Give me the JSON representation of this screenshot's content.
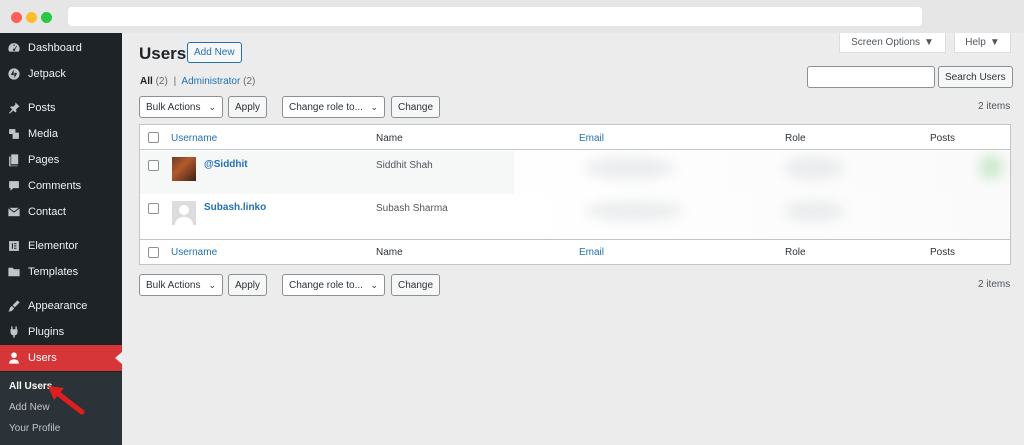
{
  "sidebar": {
    "items": [
      {
        "label": "Dashboard",
        "icon": "dashboard-icon"
      },
      {
        "label": "Jetpack",
        "icon": "jetpack-icon"
      },
      {
        "label": "Posts",
        "icon": "pin-icon"
      },
      {
        "label": "Media",
        "icon": "media-icon"
      },
      {
        "label": "Pages",
        "icon": "pages-icon"
      },
      {
        "label": "Comments",
        "icon": "comment-icon"
      },
      {
        "label": "Contact",
        "icon": "envelope-icon"
      },
      {
        "label": "Elementor",
        "icon": "elementor-icon"
      },
      {
        "label": "Templates",
        "icon": "folder-icon"
      },
      {
        "label": "Appearance",
        "icon": "brush-icon"
      },
      {
        "label": "Plugins",
        "icon": "plug-icon"
      },
      {
        "label": "Users",
        "icon": "user-icon"
      }
    ],
    "submenu": [
      "All Users",
      "Add New",
      "Your Profile"
    ]
  },
  "screen_meta": {
    "screen_options": "Screen Options",
    "help": "Help"
  },
  "header": {
    "title": "Users",
    "add_new": "Add New"
  },
  "filters": {
    "all": "All",
    "all_count": "(2)",
    "sep": "|",
    "admin": "Administrator",
    "admin_count": "(2)"
  },
  "search": {
    "button": "Search Users",
    "value": ""
  },
  "tablenav": {
    "bulk_actions": "Bulk Actions",
    "apply": "Apply",
    "change_role": "Change role to...",
    "change": "Change",
    "count": "2 items"
  },
  "table": {
    "columns": [
      "Username",
      "Name",
      "Email",
      "Role",
      "Posts"
    ],
    "rows": [
      {
        "username": "@Siddhit",
        "name": "Siddhit Shah"
      },
      {
        "username": "Subash.linko",
        "name": "Subash Sharma"
      }
    ]
  },
  "colors": {
    "accent": "#2271b1",
    "sidebar_bg": "#1d2327",
    "active": "#d63638"
  }
}
